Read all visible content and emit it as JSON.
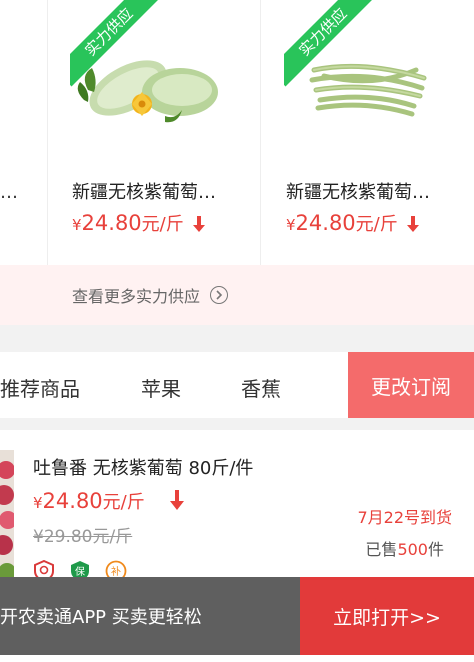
{
  "cards": {
    "ribbon_label": "实力供应",
    "partial_name_tail": "…",
    "items": [
      {
        "name": "新疆无核紫葡萄…",
        "price_symbol": "¥",
        "price": "24.80",
        "unit": "元/斤",
        "image": "zucchini-image"
      },
      {
        "name": "新疆无核紫葡萄…",
        "price_symbol": "¥",
        "price": "24.80",
        "unit": "元/斤",
        "image": "green-beans-image"
      }
    ]
  },
  "see_more": {
    "label": "查看更多实力供应"
  },
  "tabs": {
    "items": [
      "推荐商品",
      "苹果",
      "香蕉"
    ],
    "change_subscription": "更改订阅"
  },
  "list_item": {
    "title": "吐鲁番 无核紫葡萄 80斤/件",
    "price_symbol": "¥",
    "price": "24.80",
    "unit": "元/斤",
    "old_price": "¥29.80元/斤",
    "arrival": "7月22号到货",
    "sold_prefix": "已售",
    "sold_count": "500",
    "sold_suffix": "件",
    "badges": [
      {
        "icon": "certified-icon",
        "color": "#d93a3a"
      },
      {
        "icon": "guarantee-icon",
        "color": "#1f9a4a",
        "label": "保"
      },
      {
        "icon": "subsidy-icon",
        "color": "#f08a1c",
        "label": "补"
      }
    ]
  },
  "app_banner": {
    "text": "开农卖通APP  买卖更轻松",
    "open_label": "立即打开>>"
  },
  "colors": {
    "accent": "#e8413b",
    "green": "#29c45a",
    "banner_gray": "#5f5f5f"
  }
}
